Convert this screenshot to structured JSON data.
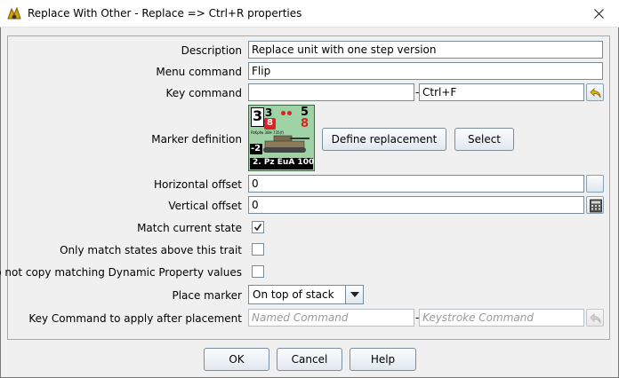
{
  "window": {
    "title": "Replace With Other - Replace => Ctrl+R properties",
    "close_glyph": "✕"
  },
  "form": {
    "description": {
      "label": "Description",
      "value": "Replace unit with one step version"
    },
    "menu_command": {
      "label": "Menu command",
      "value": "Flip"
    },
    "key_command": {
      "label": "Key command",
      "value": "",
      "separator": "-",
      "keystroke": "Ctrl+F"
    },
    "marker_definition": {
      "label": "Marker definition",
      "define_button": "Define replacement",
      "select_button": "Select",
      "counter": {
        "top_left": "3",
        "top_left_small": "3",
        "red_box": "8",
        "top_right": "5",
        "top_right_red": "8",
        "caption": "PzKpfw 38H 735(f)",
        "modifier": "-2",
        "unit_name": "2. Pz EuA 100",
        "bg_color": "#9fd3a6"
      }
    },
    "horizontal_offset": {
      "label": "Horizontal offset",
      "value": "0"
    },
    "vertical_offset": {
      "label": "Vertical offset",
      "value": "0"
    },
    "match_current_state": {
      "label": "Match current state",
      "checked": true
    },
    "only_match_above": {
      "label": "Only match states above this trait",
      "checked": false
    },
    "no_copy_dynamic": {
      "label": "Do not copy matching Dynamic Property values",
      "checked": false
    },
    "place_marker": {
      "label": "Place marker",
      "selected": "On top of stack"
    },
    "key_after_placement": {
      "label": "Key Command to apply after placement",
      "named_placeholder": "Named Command",
      "separator": "-",
      "keystroke_placeholder": "Keystroke Command"
    }
  },
  "buttons": {
    "ok": "OK",
    "cancel": "Cancel",
    "help": "Help"
  },
  "colors": {
    "accent_border": "#7a8da1",
    "icon_arrow": "#e8b000"
  }
}
